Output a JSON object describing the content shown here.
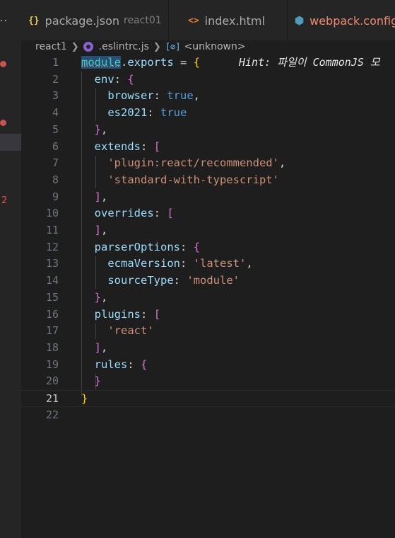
{
  "tabs": [
    {
      "icon": "{}",
      "icon_color": "#e8c84a",
      "name": "package.json",
      "desc": "react01"
    },
    {
      "icon": "<>",
      "icon_color": "#e37933",
      "name": "index.html",
      "desc": ""
    },
    {
      "icon": "⬢",
      "icon_color": "#519aba",
      "name": "webpack.config.js",
      "desc": ""
    }
  ],
  "side": {
    "error_count": "2"
  },
  "breadcrumb": {
    "folder": "react1",
    "file": ".eslintrc.js",
    "symbol": "<unknown>"
  },
  "editor": {
    "current_line": "21",
    "hint": "Hint: 파일이 CommonJS 모",
    "line_numbers": [
      "1",
      "2",
      "3",
      "4",
      "5",
      "6",
      "7",
      "8",
      "9",
      "10",
      "11",
      "12",
      "13",
      "14",
      "15",
      "16",
      "17",
      "18",
      "19",
      "20",
      "21",
      "22"
    ]
  }
}
